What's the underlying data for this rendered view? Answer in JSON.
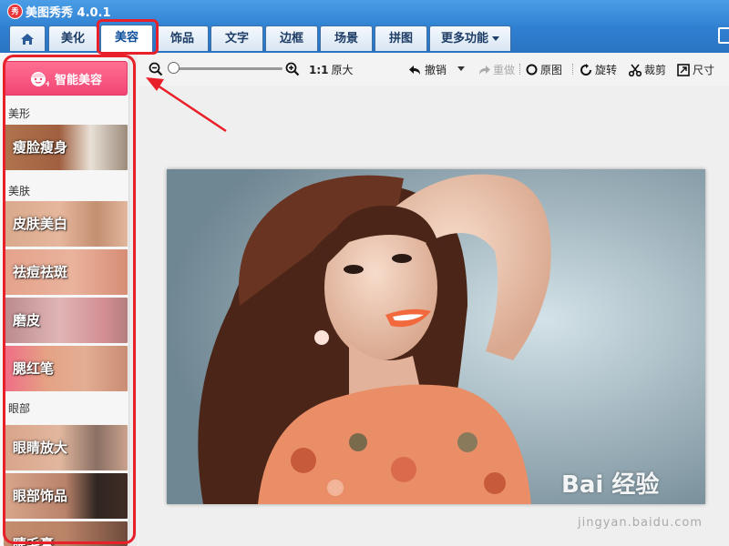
{
  "app": {
    "title": "美图秀秀 4.0.1",
    "logo_text": "秀"
  },
  "tabs": [
    {
      "label": "美化"
    },
    {
      "label": "美容",
      "active": true
    },
    {
      "label": "饰品"
    },
    {
      "label": "文字"
    },
    {
      "label": "边框"
    },
    {
      "label": "场景"
    },
    {
      "label": "拼图"
    },
    {
      "label": "更多功能"
    }
  ],
  "sidebar": {
    "smart_button": "智能美容",
    "sections": [
      {
        "label": "美形",
        "items": [
          "瘦脸瘦身"
        ]
      },
      {
        "label": "美肤",
        "items": [
          "皮肤美白",
          "祛痘祛斑",
          "磨皮",
          "腮红笔"
        ]
      },
      {
        "label": "眼部",
        "items": [
          "眼睛放大",
          "眼部饰品",
          "睫毛膏"
        ]
      }
    ]
  },
  "toolbar": {
    "ratio": "1:1",
    "original_size": "原大",
    "undo": "撤销",
    "redo": "重做",
    "original": "原图",
    "rotate": "旋转",
    "crop": "裁剪",
    "size": "尺寸"
  },
  "watermark": {
    "text": "Bai 经验",
    "sub": "jingyan.baidu.com"
  },
  "colors": {
    "accent": "#2f7fd0",
    "highlight": "#e8202a",
    "smart_button": "#f24575"
  }
}
